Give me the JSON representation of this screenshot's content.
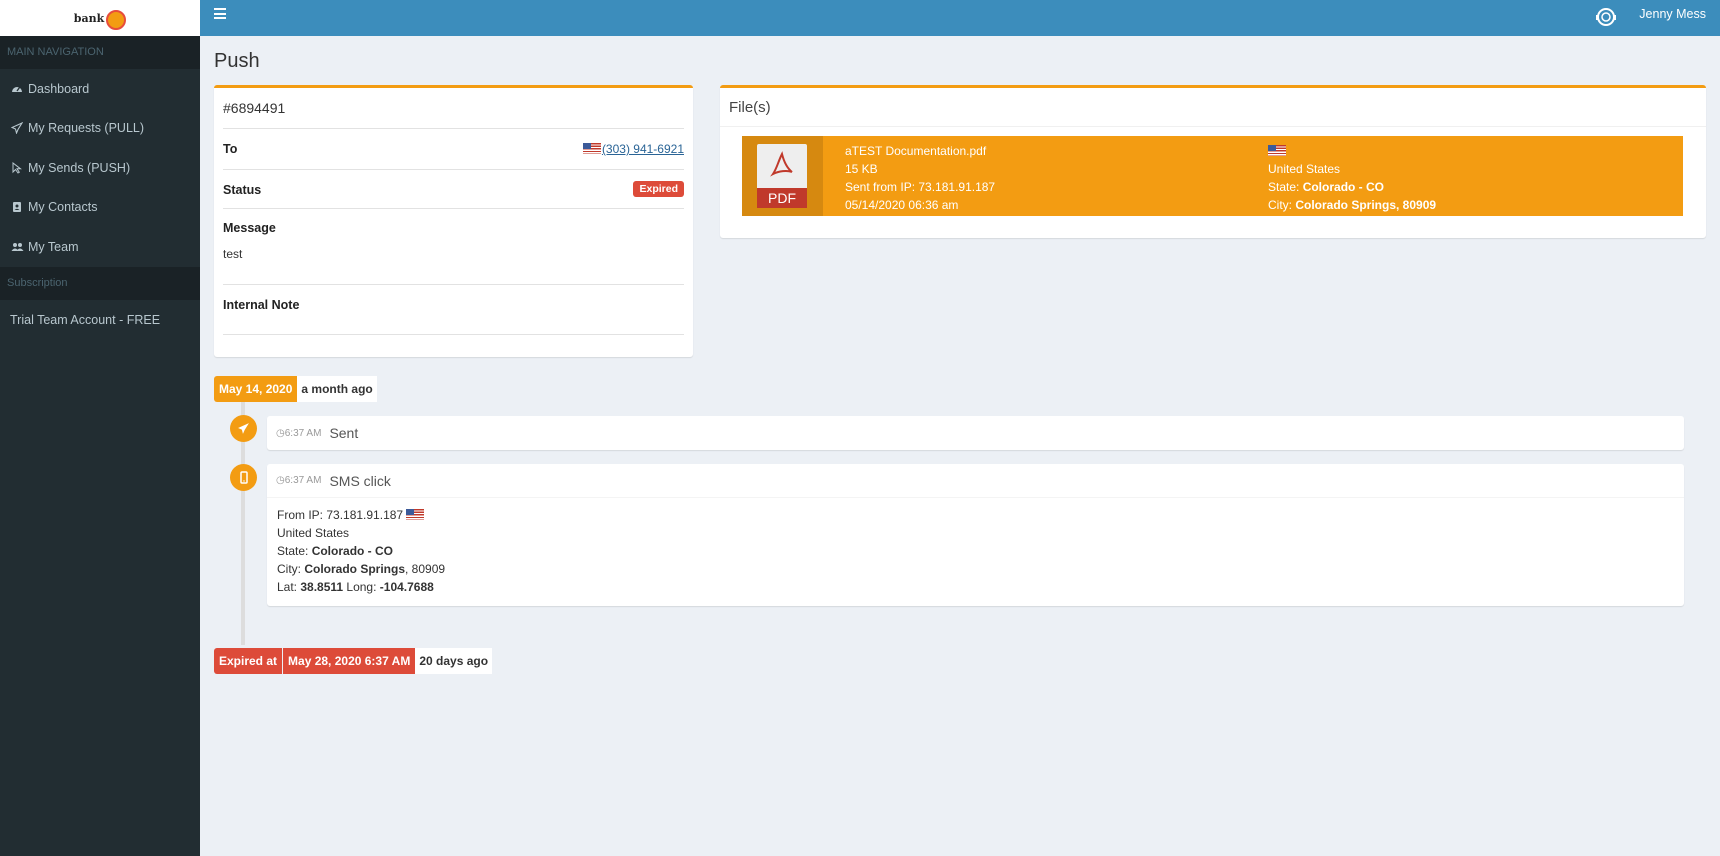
{
  "sidebar": {
    "logo_text": "bank",
    "main_nav_header": "MAIN NAVIGATION",
    "items": [
      {
        "label": "Dashboard",
        "icon": "dashboard-icon"
      },
      {
        "label": "My Requests (PULL)",
        "icon": "paper-plane-icon"
      },
      {
        "label": "My Sends (PUSH)",
        "icon": "cursor-icon"
      },
      {
        "label": "My Contacts",
        "icon": "address-book-icon"
      },
      {
        "label": "My Team",
        "icon": "users-icon"
      }
    ],
    "subscription_header": "Subscription",
    "subscription_label": "Trial Team Account - FREE"
  },
  "topbar": {
    "user_name": "Jenny Mess"
  },
  "page": {
    "title": "Push"
  },
  "request": {
    "id": "#6894491",
    "to_label": "To",
    "phone": "(303) 941-6921",
    "status_label": "Status",
    "status_value": "Expired",
    "message_label": "Message",
    "message_value": "test",
    "note_label": "Internal Note"
  },
  "files": {
    "title": "File(s)",
    "items": [
      {
        "icon_label": "PDF",
        "name": "aTEST Documentation.pdf",
        "size": "15 KB",
        "sent_from": "Sent from IP: 73.181.91.187",
        "datetime": "05/14/2020 06:36 am",
        "country": "United States",
        "state_label": "State: ",
        "state": "Colorado - CO",
        "city_label": "City: ",
        "city": "Colorado Springs, 80909"
      }
    ]
  },
  "timeline": {
    "date": "May 14, 2020",
    "date_relative": "a month ago",
    "events": [
      {
        "time": "6:37 AM",
        "title": "Sent"
      },
      {
        "time": "6:37 AM",
        "title": "SMS click",
        "ip_label": "From IP: ",
        "ip": "73.181.91.187",
        "country": "United States",
        "state_label": "State: ",
        "state": "Colorado - CO",
        "city_label": "City: ",
        "city": "Colorado Springs",
        "zip": ", 80909",
        "lat_label": "Lat: ",
        "lat": "38.8511",
        "long_label": " Long: ",
        "long": "-104.7688"
      }
    ],
    "expired_label": "Expired at",
    "expired_date": "May 28, 2020 6:37 AM",
    "expired_relative": "20 days ago"
  },
  "colors": {
    "accent": "#f39c12",
    "topbar": "#3c8dbc",
    "sidebar": "#222d32",
    "danger": "#dd4b39"
  }
}
